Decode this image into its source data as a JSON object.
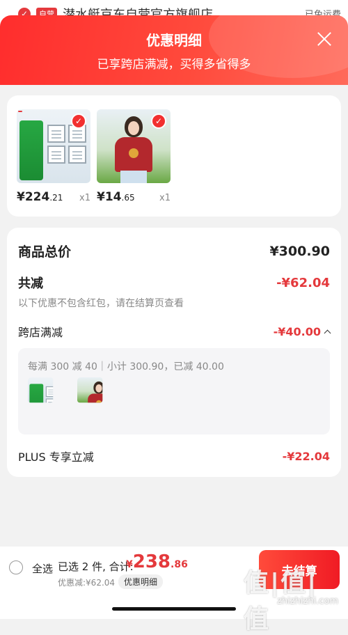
{
  "background_page": {
    "store_tag": "自营",
    "store_name": "潜水艇京东自营官方旗舰店",
    "shipping": "已免运费"
  },
  "sheet": {
    "title": "优惠明细",
    "subtitle": "已享跨店满减，买得多省得多"
  },
  "products": [
    {
      "image": "bathroom-heater-product-image",
      "price_int": "¥224",
      "price_dec": ".21",
      "qty": "x1",
      "selected": true
    },
    {
      "image": "tshirt-model-product-image",
      "price_int": "¥14",
      "price_dec": ".65",
      "qty": "x1",
      "selected": true
    }
  ],
  "summary": {
    "total_label": "商品总价",
    "total_value": "¥300.90",
    "reduce_label": "共减",
    "reduce_value": "-¥62.04",
    "note": "以下优惠不包含红包，请在结算页查看",
    "cross_label": "跨店满减",
    "cross_value": "-¥40.00",
    "cross_rule": "每满 300 减 40｜小计 300.90，已减 40.00",
    "plus_label": "PLUS 专享立减",
    "plus_value": "-¥22.04"
  },
  "bottom": {
    "select_all": "全选",
    "selected_count": "已选 2 件, 合计:",
    "total_symbol": "¥",
    "total_int": "238",
    "total_dec": ".86",
    "saved": "优惠减:¥62.04",
    "promo_link": "优惠明细",
    "checkout": "去结算"
  },
  "watermark": {
    "logo": "值|值|值",
    "url": "zhizhizhi.com"
  },
  "colors": {
    "accent_red": "#e4393c",
    "header_gradient_start": "#ff2d2d",
    "header_gradient_end": "#ff6a5a"
  }
}
